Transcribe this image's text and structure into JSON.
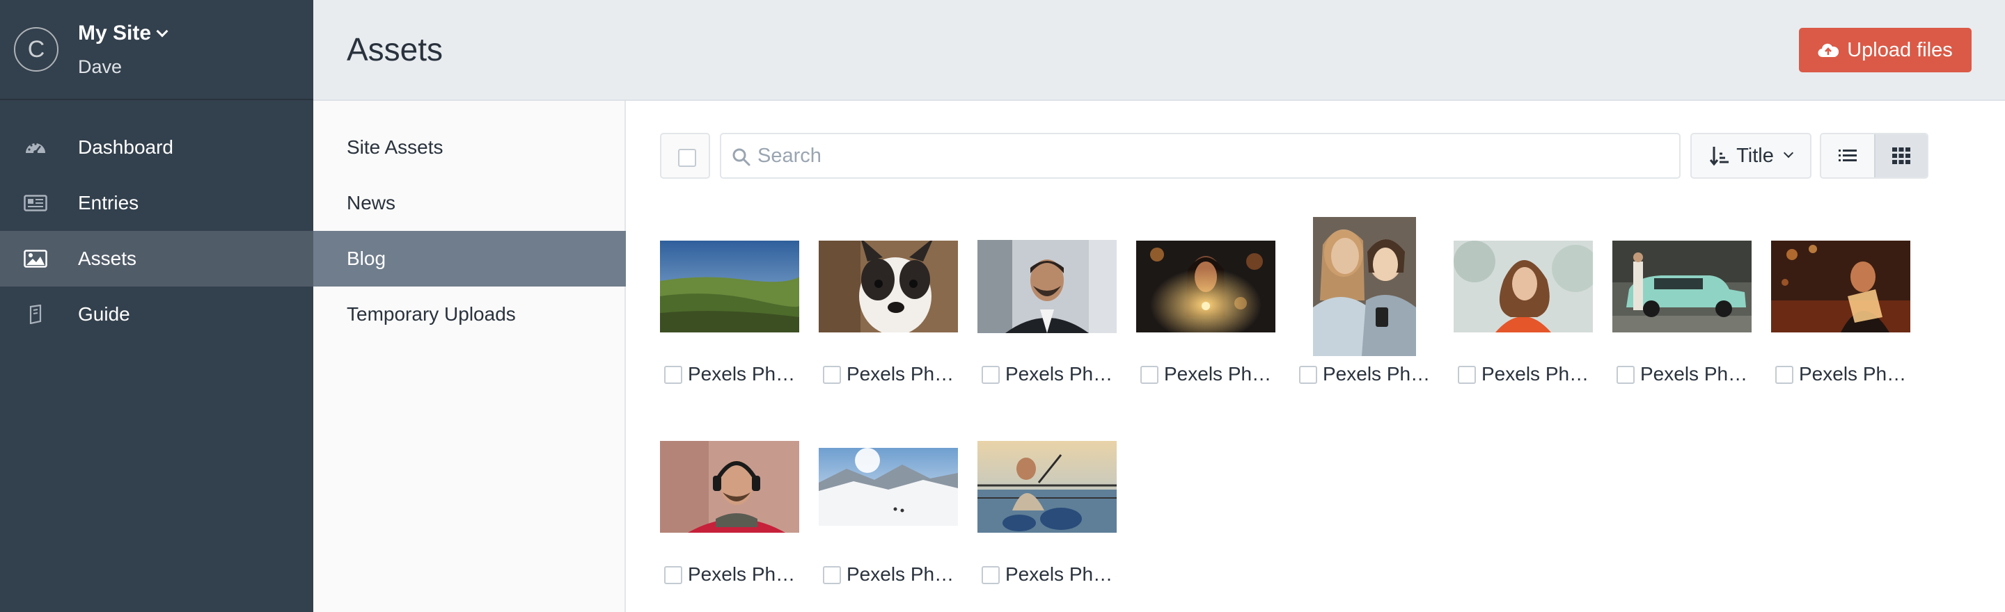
{
  "site": {
    "logo_letter": "C",
    "name": "My Site",
    "user": "Dave"
  },
  "global_nav": [
    {
      "label": "Dashboard",
      "icon": "dashboard-gauge-icon",
      "selected": false
    },
    {
      "label": "Entries",
      "icon": "newspaper-icon",
      "selected": false
    },
    {
      "label": "Assets",
      "icon": "image-icon",
      "selected": true
    },
    {
      "label": "Guide",
      "icon": "book-icon",
      "selected": false
    }
  ],
  "header": {
    "title": "Assets",
    "upload_label": "Upload files",
    "upload_icon": "cloud-upload-icon"
  },
  "sources": [
    {
      "label": "Site Assets",
      "selected": false
    },
    {
      "label": "News",
      "selected": false
    },
    {
      "label": "Blog",
      "selected": true
    },
    {
      "label": "Temporary Uploads",
      "selected": false
    }
  ],
  "toolbar": {
    "search_placeholder": "Search",
    "sort_label": "Title",
    "view_modes": [
      "list-view-icon",
      "grid-view-icon"
    ],
    "active_view": "grid"
  },
  "assets": [
    {
      "title": "Pexels Ph…",
      "subject": "aerial green valley landscape"
    },
    {
      "title": "Pexels Ph…",
      "subject": "french bulldog puppy"
    },
    {
      "title": "Pexels Ph…",
      "subject": "man in suit portrait"
    },
    {
      "title": "Pexels Ph…",
      "subject": "woman holding lights at night"
    },
    {
      "title": "Pexels Ph…",
      "subject": "two women looking at phone"
    },
    {
      "title": "Pexels Ph…",
      "subject": "woman with curly hair in snow"
    },
    {
      "title": "Pexels Ph…",
      "subject": "man beside vintage teal car"
    },
    {
      "title": "Pexels Ph…",
      "subject": "man with laptop in warm light"
    },
    {
      "title": "Pexels Ph…",
      "subject": "man wearing headphones"
    },
    {
      "title": "Pexels Ph…",
      "subject": "skiers on snowy mountain"
    },
    {
      "title": "Pexels Ph…",
      "subject": "drummer on deck"
    }
  ],
  "colors": {
    "sidebar_bg": "#33404d",
    "sidebar_selected": "#515c69",
    "source_selected": "#6f7d8c",
    "upload_button": "#da5a47",
    "header_bg": "#e9ecef"
  }
}
